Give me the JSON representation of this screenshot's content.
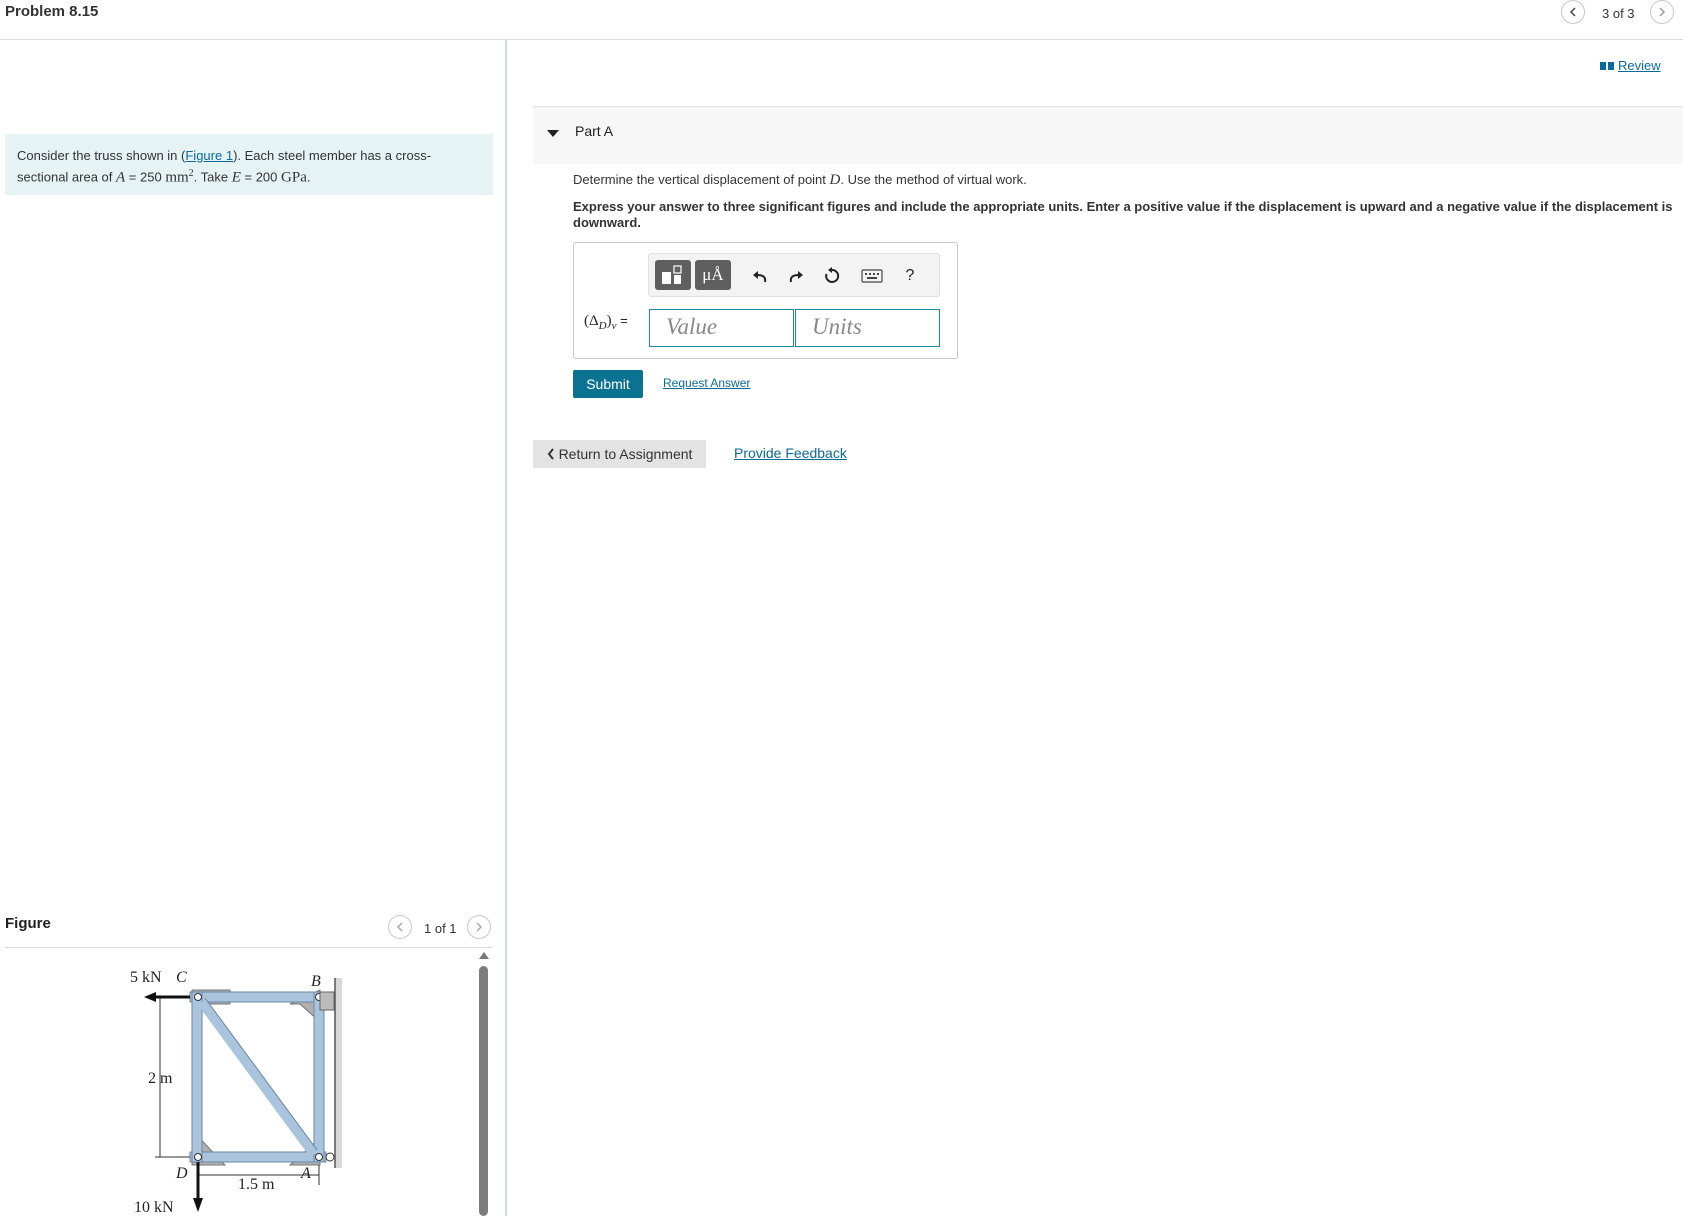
{
  "header": {
    "title": "Problem 8.15",
    "pager": "3 of 3"
  },
  "problem": {
    "text_before": "Consider the truss shown in (",
    "figure_link": "Figure 1",
    "text_after": "). Each steel member has a cross-sectional area of ",
    "var_A": "A",
    "eq1": " = 250 ",
    "unit_area": "mm",
    "sup": "2",
    "text_take": ". Take ",
    "var_E": "E",
    "eq2": " = 200 ",
    "unit_E": "GPa",
    "period": "."
  },
  "figure": {
    "heading": "Figure",
    "pager": "1 of 1",
    "labels": {
      "load_c": "5 kN",
      "node_c": "C",
      "node_b": "B",
      "node_d": "D",
      "node_a": "A",
      "height": "2 m",
      "width": "1.5 m",
      "load_d": "10 kN"
    }
  },
  "review": {
    "label": "Review"
  },
  "partA": {
    "label": "Part A",
    "question_before": "Determine the vertical displacement of point ",
    "question_point": "D",
    "question_after": ". Use the method of virtual work.",
    "instruction": "Express your answer to three significant figures and include the appropriate units. Enter a positive value if the displacement is upward and a negative value if the displacement is downward.",
    "toolbar": {
      "units_label": "μÅ",
      "help_label": "?"
    },
    "answer_label": {
      "open": "(Δ",
      "sub": "D",
      "close": ")",
      "sub2": "v",
      "eq": " ="
    },
    "value_placeholder": "Value",
    "units_placeholder": "Units",
    "submit_label": "Submit",
    "request_label": "Request Answer"
  },
  "footer": {
    "return_label": "Return to Assignment",
    "feedback_label": "Provide Feedback"
  },
  "colors": {
    "accent": "#0b7291",
    "link": "#0a6a9c",
    "problem_bg": "#e6f3f5",
    "truss_member": "#a9c4dc"
  }
}
